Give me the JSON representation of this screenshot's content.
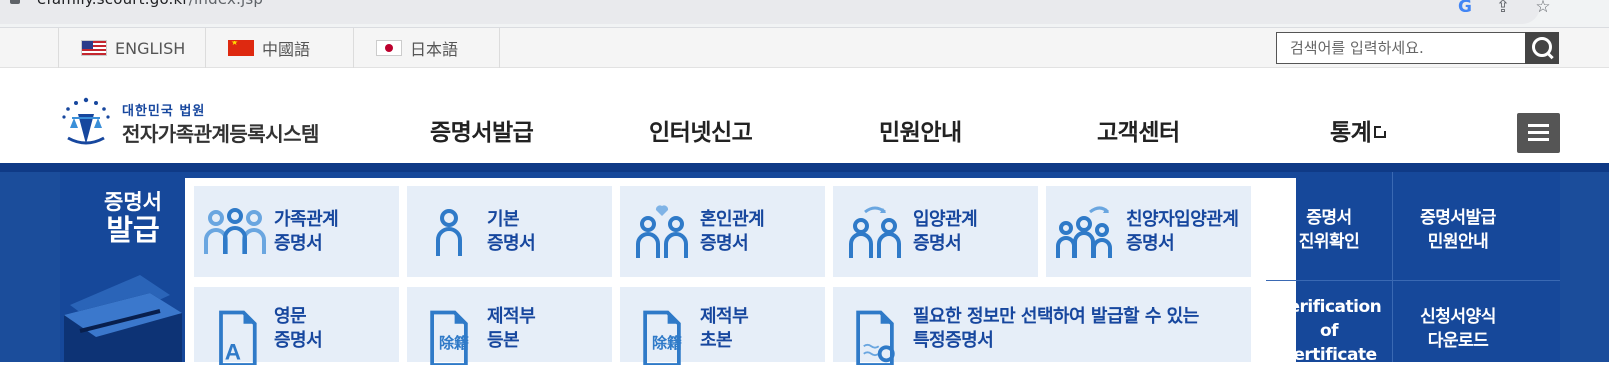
{
  "browser": {
    "url_host": "efamily.scourt.go.kr",
    "url_path": "/index.jsp"
  },
  "languages": [
    {
      "label": "ENGLISH",
      "flag": "us-flag-icon"
    },
    {
      "label": "中國語",
      "flag": "china-flag-icon"
    },
    {
      "label": "日本語",
      "flag": "japan-flag-icon"
    }
  ],
  "search": {
    "placeholder": "검색어를 입력하세요."
  },
  "logo": {
    "line1": "대한민국 법원",
    "line2": "전자가족관계등록시스템"
  },
  "nav": [
    {
      "label": "증명서발급"
    },
    {
      "label": "인터넷신고"
    },
    {
      "label": "민원안내"
    },
    {
      "label": "고객센터"
    },
    {
      "label": "통계",
      "external": true
    }
  ],
  "category": {
    "line1": "증명서",
    "line2": "발급"
  },
  "certificates": [
    {
      "line1": "가족관계",
      "line2": "증명서",
      "icon": "family-icon"
    },
    {
      "line1": "기본",
      "line2": "증명서",
      "icon": "person-icon"
    },
    {
      "line1": "혼인관계",
      "line2": "증명서",
      "icon": "marriage-icon"
    },
    {
      "line1": "입양관계",
      "line2": "증명서",
      "icon": "adoption-icon"
    },
    {
      "line1": "친양자입양관계",
      "line2": "증명서",
      "icon": "full-adoption-icon"
    },
    {
      "line1": "영문",
      "line2": "증명서",
      "icon": "english-document-icon"
    },
    {
      "line1": "제적부",
      "line2": "등본",
      "icon": "removed-register-document-icon",
      "tag": "除籍"
    },
    {
      "line1": "제적부",
      "line2": "초본",
      "icon": "removed-register-document-icon",
      "tag": "除籍"
    },
    {
      "line1": "필요한 정보만 선택하여 발급할 수 있는",
      "line2": "특정증명서",
      "icon": "document-search-icon"
    }
  ],
  "side_links": [
    {
      "line1": "증명서",
      "line2": "진위확인"
    },
    {
      "line1": "증명서발급",
      "line2": "민원안내"
    },
    {
      "line1": "Verification of",
      "line2": "Certificate"
    },
    {
      "line1": "신청서양식",
      "line2": "다운로드"
    }
  ],
  "colors": {
    "brand_blue": "#17479e",
    "band": "#1b4d9b",
    "tile_bg": "#e6eef8",
    "icon_blue": "#2f7ac8"
  }
}
